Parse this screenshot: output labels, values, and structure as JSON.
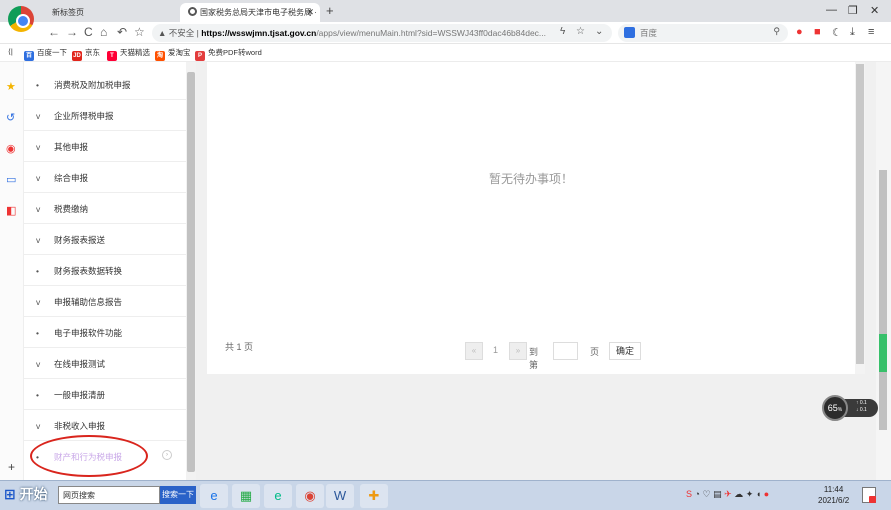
{
  "browser": {
    "tabs": [
      {
        "label": "新标签页",
        "active": false
      },
      {
        "label": "国家税务总局天津市电子税务局 ·",
        "active": true
      }
    ],
    "url": {
      "warning": "▲ 不安全 |",
      "host": "https://wsswjmn.tjsat.gov.cn",
      "path": "/apps/view/menuMain.html?sid=WSSWJ43ff0dac46b84dec..."
    },
    "search_placeholder": "百度",
    "bookmarks": [
      {
        "label": "百度一下",
        "color": "#2f6fe0",
        "glyph": "百"
      },
      {
        "label": "京东",
        "color": "#e1251b",
        "glyph": "JD"
      },
      {
        "label": "天猫精选",
        "color": "#ff0036",
        "glyph": "T"
      },
      {
        "label": "爱淘宝",
        "color": "#ff5000",
        "glyph": "淘"
      },
      {
        "label": "免费PDF转word",
        "color": "#e33d3d",
        "glyph": "P"
      }
    ]
  },
  "menu": {
    "items": [
      {
        "marker": "•",
        "label": "消费税及附加税申报"
      },
      {
        "marker": "v",
        "label": "企业所得税申报"
      },
      {
        "marker": "v",
        "label": "其他申报"
      },
      {
        "marker": "v",
        "label": "综合申报"
      },
      {
        "marker": "v",
        "label": "税费缴纳"
      },
      {
        "marker": "v",
        "label": "财务报表报送"
      },
      {
        "marker": "•",
        "label": "财务报表数据转换"
      },
      {
        "marker": "v",
        "label": "申报辅助信息报告"
      },
      {
        "marker": "•",
        "label": "电子申报软件功能"
      },
      {
        "marker": "v",
        "label": "在线申报测试"
      },
      {
        "marker": "•",
        "label": "一般申报清册"
      },
      {
        "marker": "v",
        "label": "非税收入申报"
      },
      {
        "marker": "•",
        "label": "财产和行为税申报",
        "active": true
      }
    ]
  },
  "main": {
    "empty_message": "暂无待办事项！",
    "pager": {
      "total": "共 1 页",
      "prev": "«",
      "current": "1",
      "next": "»",
      "goto_label": "到第",
      "page_unit": "页",
      "confirm": "确定"
    }
  },
  "speed_widget": {
    "percent": "65",
    "unit": "%",
    "up": "0.1",
    "down": "0.1"
  },
  "taskbar": {
    "start_label": "开始",
    "search_value": "网页搜索",
    "search_button": "搜索一下",
    "time": "11:44",
    "date": "2021/6/2"
  }
}
